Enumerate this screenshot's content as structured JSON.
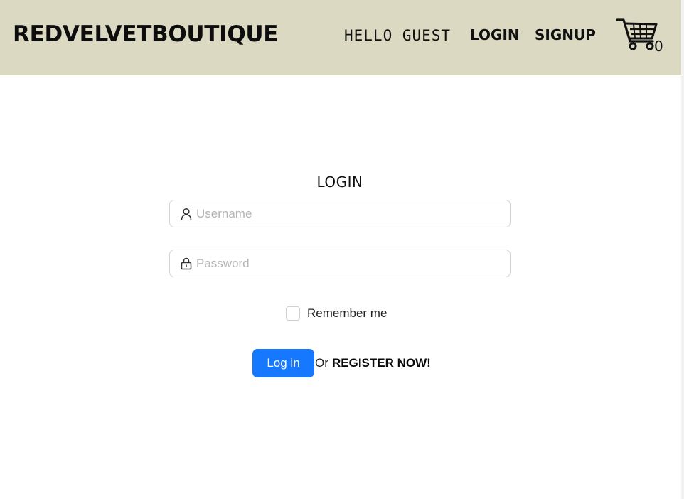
{
  "header": {
    "brand": "REDVELVETBOUTIQUE",
    "greeting": "HELLO GUEST",
    "nav": {
      "login_label": "LOGIN",
      "signup_label": "SIGNUP"
    },
    "cart": {
      "icon": "shopping-cart-icon",
      "count": "0"
    },
    "background_color": "#dcd9c2"
  },
  "login_form": {
    "title": "LOGIN",
    "username": {
      "icon": "user-icon",
      "value": "",
      "placeholder": "Username"
    },
    "password": {
      "icon": "lock-icon",
      "value": "",
      "placeholder": "Password"
    },
    "remember_me": {
      "label": "Remember me",
      "checked": false
    },
    "submit_label": "Log in",
    "or_text": "Or",
    "register_label": "REGISTER NOW!",
    "accent_color": "#1677ff"
  }
}
